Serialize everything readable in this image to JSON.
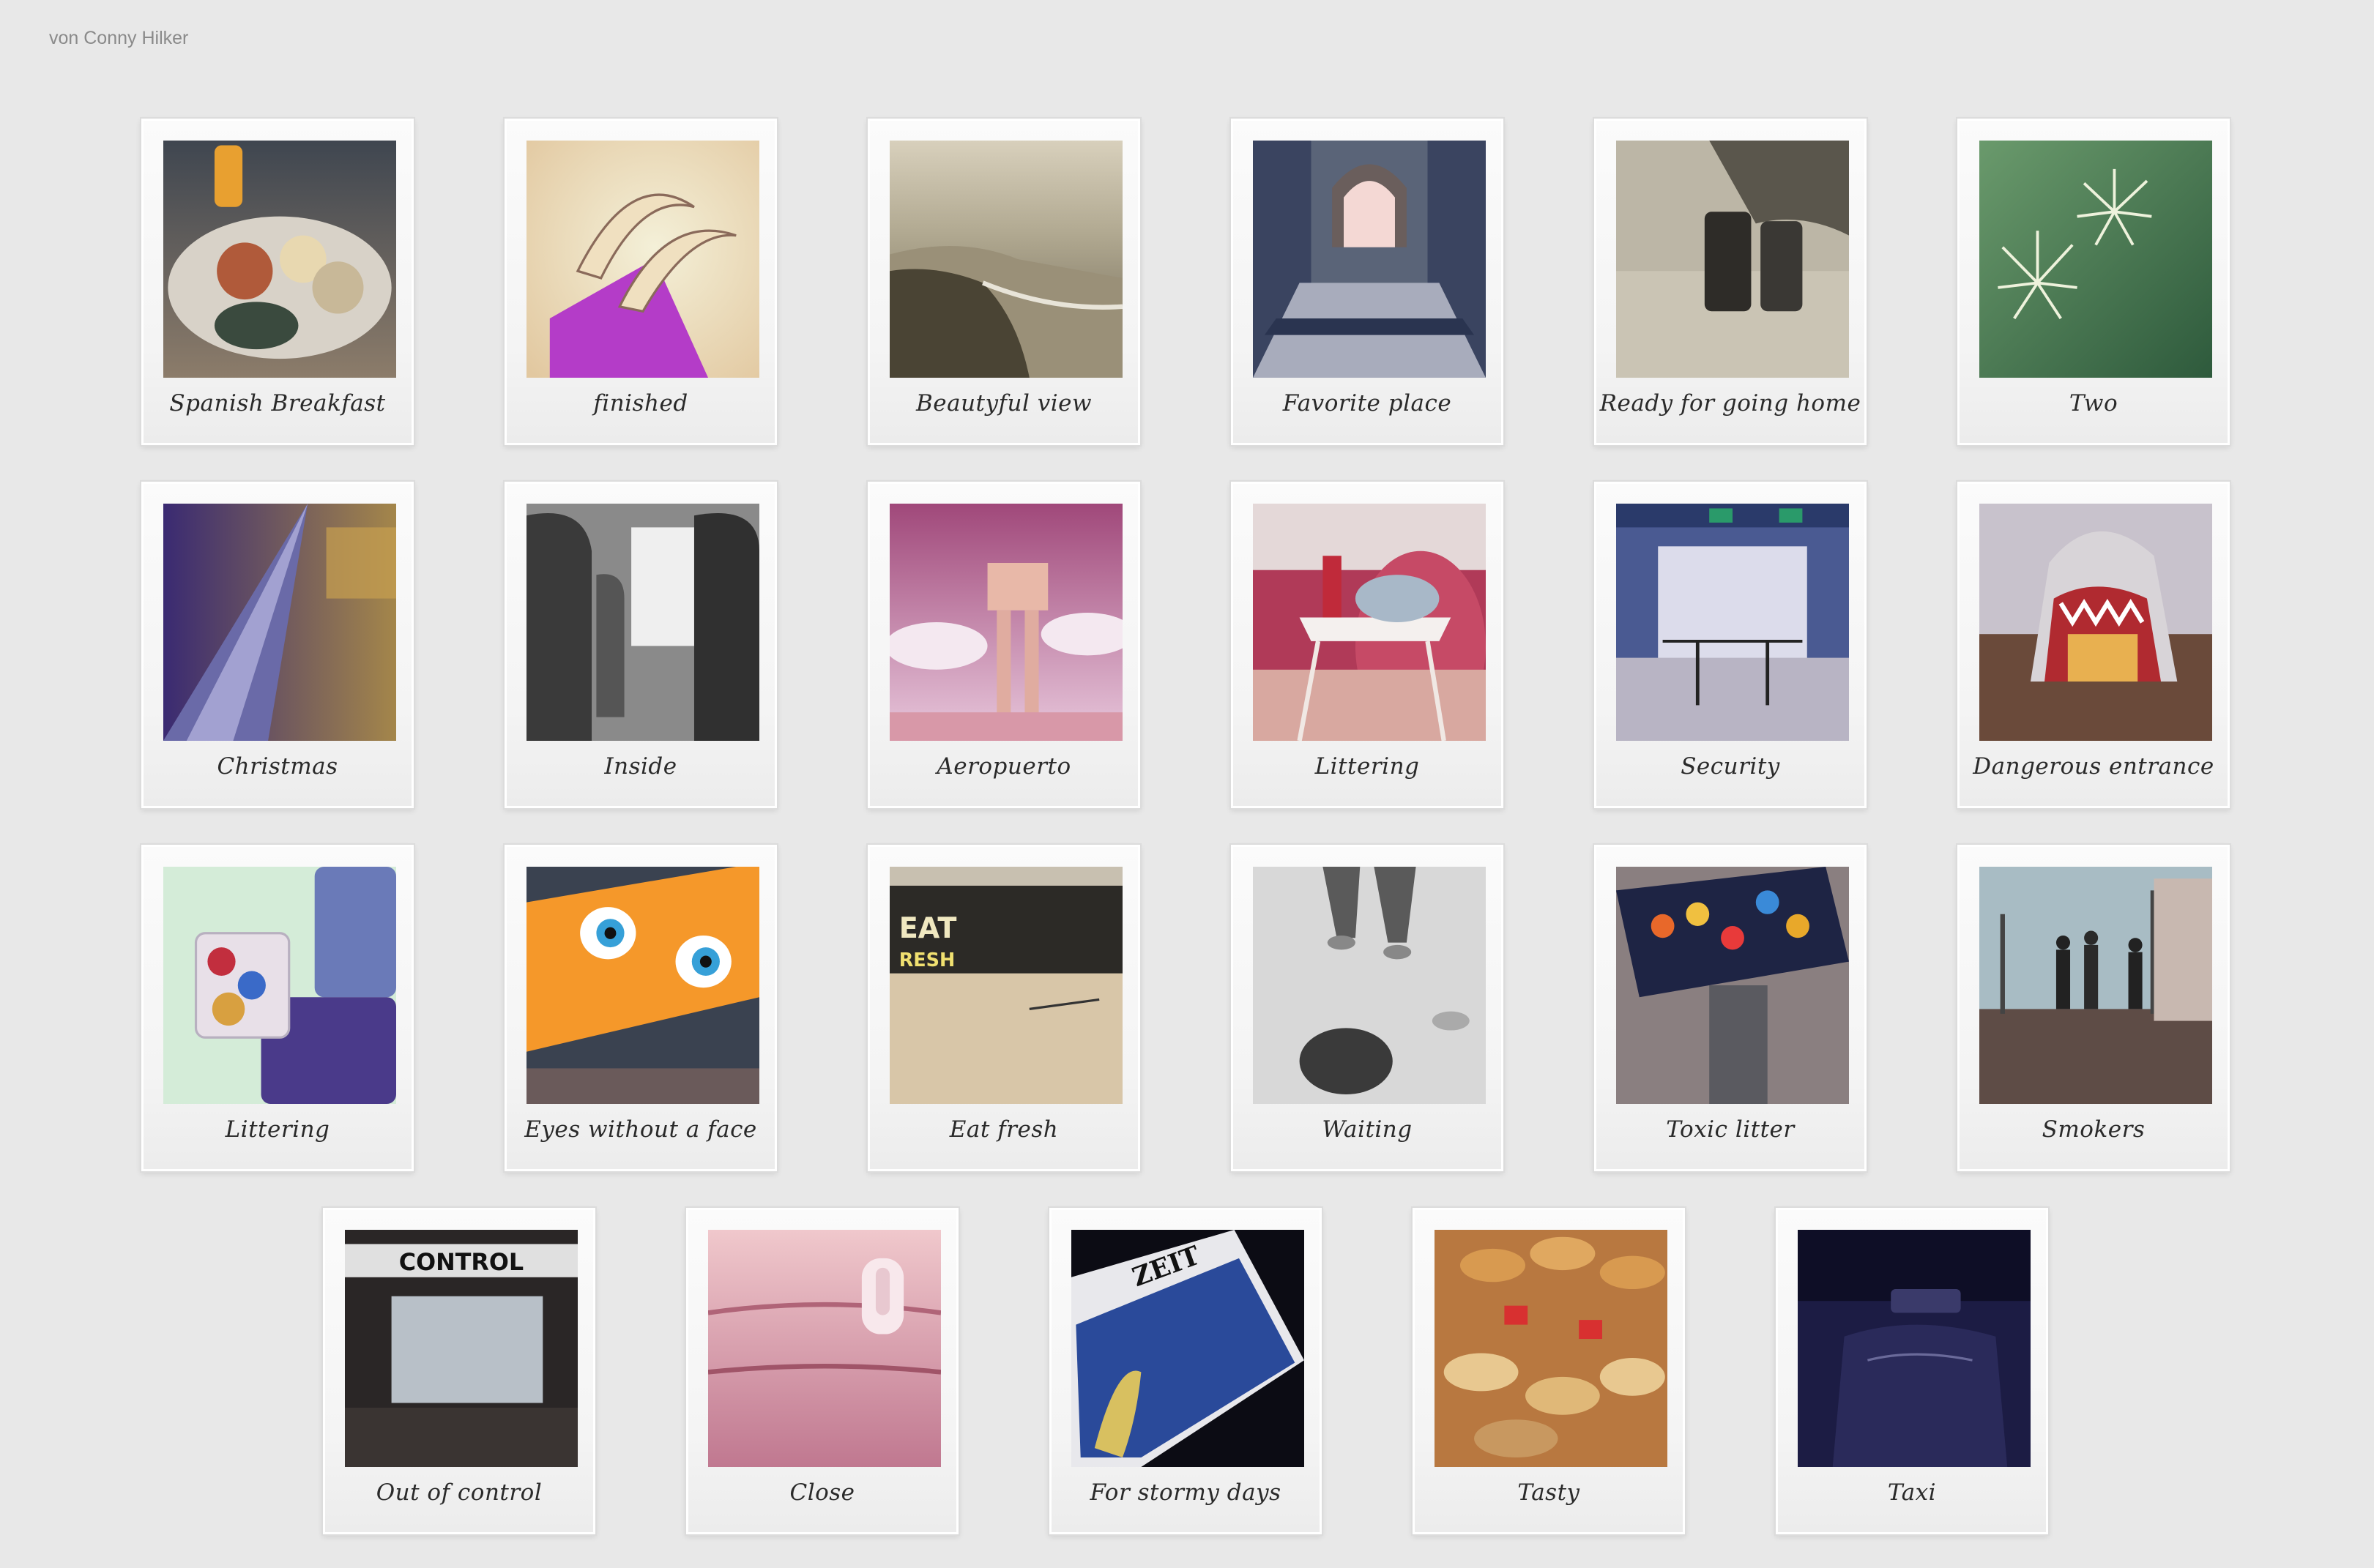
{
  "author": "von Conny Hilker",
  "photos": [
    {
      "caption": "Spanish Breakfast",
      "icon": "breakfast-plate",
      "bg": [
        "#6c7a86",
        "#b7a98c"
      ],
      "accent": "#e0a23a"
    },
    {
      "caption": "finished",
      "icon": "melon-slice",
      "bg": [
        "#f0e8a8",
        "#e6d4a6"
      ],
      "accent": "#c23bd0"
    },
    {
      "caption": "Beautyful view",
      "icon": "coast-landscape",
      "bg": [
        "#cfc6b2",
        "#6e6650"
      ],
      "accent": "#4d4535"
    },
    {
      "caption": "Favorite place",
      "icon": "arched-doorway",
      "bg": [
        "#55607a",
        "#9aa0b2"
      ],
      "accent": "#f2d8cf"
    },
    {
      "caption": "Ready for going home",
      "icon": "luggage-bags",
      "bg": [
        "#bdb7a6",
        "#8c8778"
      ],
      "accent": "#333330"
    },
    {
      "caption": "Two",
      "icon": "cactus-pair",
      "bg": [
        "#5b8a5c",
        "#3e6a48"
      ],
      "accent": "#e9ecd8"
    },
    {
      "caption": "Christmas",
      "icon": "christmas-tree",
      "bg": [
        "#3b2c6b",
        "#a08a4a"
      ],
      "accent": "#d8d3f0"
    },
    {
      "caption": "Inside",
      "icon": "bus-seats",
      "bg": [
        "#9a9a9a",
        "#3d3d3d"
      ],
      "accent": "#f0f0f0"
    },
    {
      "caption": "Aeropuerto",
      "icon": "control-tower",
      "bg": [
        "#b86da0",
        "#f5d8ea"
      ],
      "accent": "#f0d0c8"
    },
    {
      "caption": "Littering",
      "icon": "table-with-trash",
      "bg": [
        "#b23c5a",
        "#efe0dc"
      ],
      "accent": "#ffffff"
    },
    {
      "caption": "Security",
      "icon": "security-gate",
      "bg": [
        "#3a4f8a",
        "#d9d9e8"
      ],
      "accent": "#2a8a6a"
    },
    {
      "caption": "Dangerous entrance",
      "icon": "shark-mouth",
      "bg": [
        "#c6c0c8",
        "#5a3a3a"
      ],
      "accent": "#e24848"
    },
    {
      "caption": "Littering",
      "icon": "trash-tray",
      "bg": [
        "#cfe8d2",
        "#5f7fae"
      ],
      "accent": "#c22e3e"
    },
    {
      "caption": "Eyes without a face",
      "icon": "cartoon-eyes",
      "bg": [
        "#f59a2a",
        "#313846"
      ],
      "accent": "#36a0d8"
    },
    {
      "caption": "Eat fresh",
      "icon": "food-court",
      "bg": [
        "#2c2a26",
        "#e8d8bc"
      ],
      "accent": "#f0e070"
    },
    {
      "caption": "Waiting",
      "icon": "legs-on-floor",
      "bg": [
        "#e8e8e8",
        "#a8a8a8"
      ],
      "accent": "#444444"
    },
    {
      "caption": "Toxic litter",
      "icon": "bin-of-cans",
      "bg": [
        "#1e2444",
        "#8a7f80"
      ],
      "accent": "#e8682a"
    },
    {
      "caption": "Smokers",
      "icon": "window-silhouettes",
      "bg": [
        "#9eb0b8",
        "#5e4c46"
      ],
      "accent": "#2a2a2a"
    },
    {
      "caption": "Out of control",
      "icon": "control-sign",
      "bg": [
        "#2a2626",
        "#b8c0c8"
      ],
      "accent": "#f0f0f0"
    },
    {
      "caption": "Close",
      "icon": "pink-latch",
      "bg": [
        "#e8b8c0",
        "#c07890"
      ],
      "accent": "#f8e8ec"
    },
    {
      "caption": "For stormy days",
      "icon": "newspaper-tablet",
      "bg": [
        "#0c0c14",
        "#2a4a9a"
      ],
      "accent": "#f0f0f0"
    },
    {
      "caption": "Tasty",
      "icon": "pastry-display",
      "bg": [
        "#b87840",
        "#e8c890"
      ],
      "accent": "#d83030"
    },
    {
      "caption": "Taxi",
      "icon": "taxi-interior",
      "bg": [
        "#1c1c44",
        "#0e0e26"
      ],
      "accent": "#6a6a9a"
    }
  ]
}
